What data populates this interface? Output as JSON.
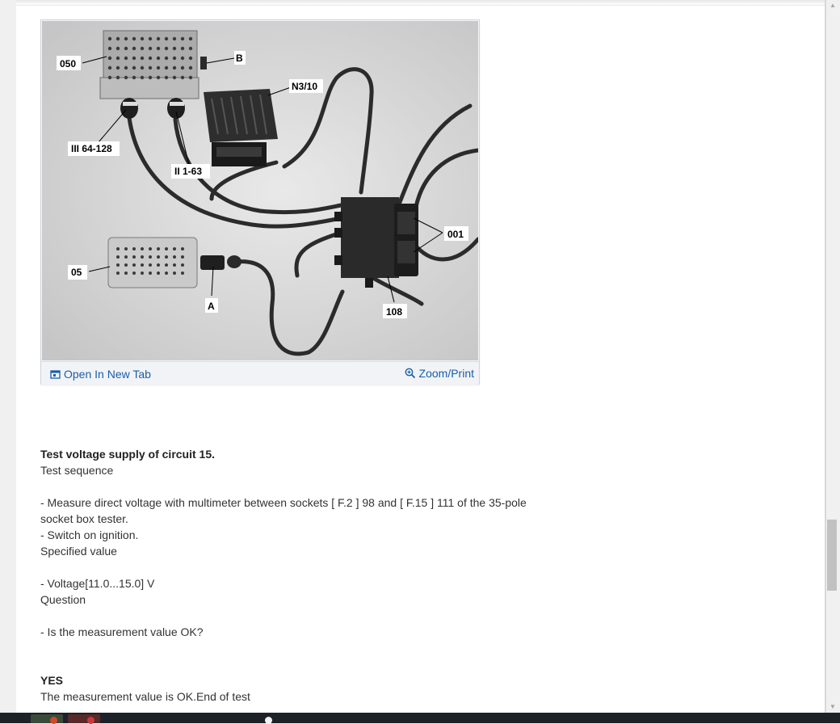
{
  "figure": {
    "labels": {
      "l050": "050",
      "lB": "B",
      "lN310": "N3/10",
      "lIII": "III 64-128",
      "lII": "II 1-63",
      "l001": "001",
      "l05": "05",
      "lA": "A",
      "l108": "108"
    },
    "open_new_tab": "Open In New Tab",
    "zoom_print": "Zoom/Print",
    "icons": {
      "open": "open-in-new-tab-icon",
      "zoom": "zoom-magnifier-icon"
    }
  },
  "body": {
    "heading": "Test voltage supply of circuit 15.",
    "test_sequence_label": "Test sequence",
    "step1_line1": " -  Measure direct voltage with multimeter between sockets [ F.2 ] 98 and [ F.15 ] 111 of the 35-pole",
    "step1_line2": "socket box tester.",
    "step2": " -  Switch on ignition.",
    "specified_value_label": "Specified value",
    "voltage": " -  Voltage[11.0...15.0] V",
    "question_label": "Question",
    "question": " -  Is the measurement value OK?",
    "yes_label": "YES",
    "yes_text": "The measurement value is OK.End of test"
  },
  "colors": {
    "link": "#1a5ea8",
    "text": "#333333",
    "scroll_thumb": "#c1c1c1"
  }
}
